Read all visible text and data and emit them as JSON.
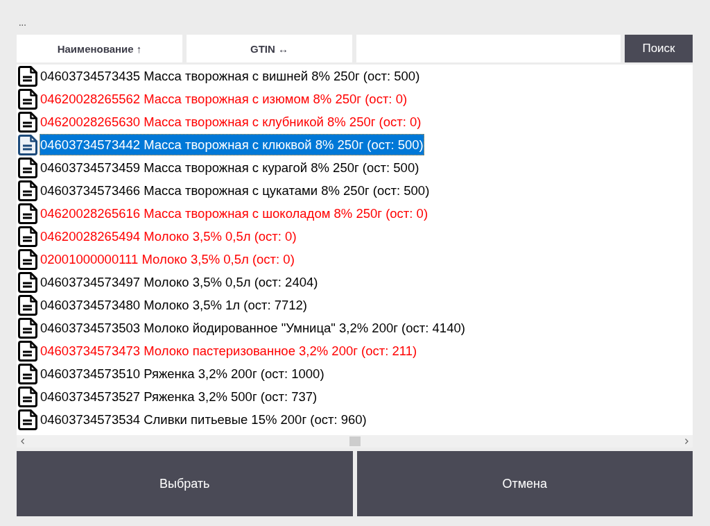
{
  "title": "...",
  "columns": [
    {
      "label": "Наименование ↑"
    },
    {
      "label": "GTIN ↔"
    }
  ],
  "search": {
    "button": "Поиск"
  },
  "items": [
    {
      "text": "04603734573435 Масса творожная с вишней 8% 250г (ост: 500)",
      "warning": false,
      "selected": false
    },
    {
      "text": "04620028265562 Масса творожная с изюмом 8% 250г (ост: 0)",
      "warning": true,
      "selected": false
    },
    {
      "text": "04620028265630 Масса творожная с клубникой 8% 250г (ост: 0)",
      "warning": true,
      "selected": false
    },
    {
      "text": "04603734573442 Масса творожная с клюквой 8% 250г (ост: 500)",
      "warning": false,
      "selected": true
    },
    {
      "text": "04603734573459 Масса творожная с курагой 8% 250г (ост: 500)",
      "warning": false,
      "selected": false
    },
    {
      "text": "04603734573466 Масса творожная с цукатами 8% 250г (ост: 500)",
      "warning": false,
      "selected": false
    },
    {
      "text": "04620028265616 Масса творожная с шоколадом 8% 250г (ост: 0)",
      "warning": true,
      "selected": false
    },
    {
      "text": "04620028265494 Молоко 3,5% 0,5л (ост: 0)",
      "warning": true,
      "selected": false
    },
    {
      "text": "02001000000111 Молоко 3,5% 0,5л (ост: 0)",
      "warning": true,
      "selected": false
    },
    {
      "text": "04603734573497 Молоко 3,5% 0,5л (ост: 2404)",
      "warning": false,
      "selected": false
    },
    {
      "text": "04603734573480 Молоко 3,5% 1л (ост: 7712)",
      "warning": false,
      "selected": false
    },
    {
      "text": "04603734573503 Молоко йодированное \"Умница\" 3,2% 200г (ост: 4140)",
      "warning": false,
      "selected": false
    },
    {
      "text": "04603734573473 Молоко пастеризованное 3,2% 200г (ост: 211)",
      "warning": true,
      "selected": false
    },
    {
      "text": "04603734573510 Ряженка 3,2% 200г (ост: 1000)",
      "warning": false,
      "selected": false
    },
    {
      "text": "04603734573527 Ряженка 3,2% 500г (ост: 737)",
      "warning": false,
      "selected": false
    },
    {
      "text": "04603734573534 Сливки питьевые 15% 200г (ост: 960)",
      "warning": false,
      "selected": false
    }
  ],
  "buttons": [
    "Выбрать",
    "Отмена"
  ]
}
